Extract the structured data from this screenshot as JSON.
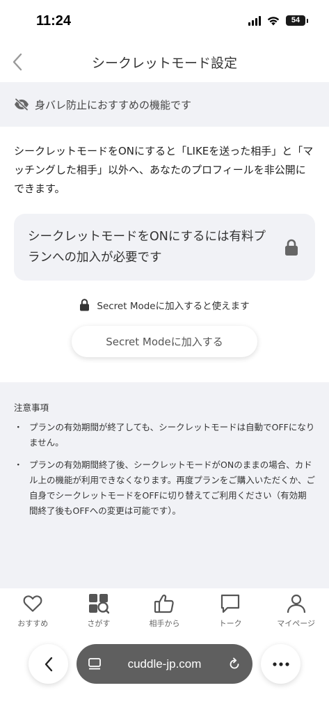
{
  "status_bar": {
    "time": "11:24",
    "battery": "54"
  },
  "header": {
    "title": "シークレットモード設定"
  },
  "feature_banner": {
    "text": "身バレ防止におすすめの機能です"
  },
  "description": "シークレットモードをONにすると「LIKEを送った相手」と「マッチングした相手」以外へ、あなたのプロフィールを非公開にできます。",
  "locked_card": {
    "text": "シークレットモードをONにするには有料プランへの加入が必要です"
  },
  "secret_note": "Secret Modeに加入すると使えます",
  "join_button": "Secret Modeに加入する",
  "notes": {
    "title": "注意事項",
    "items": [
      {
        "bullet": "・",
        "text": "プランの有効期間が終了しても、シークレットモードは自動でOFFになりません。"
      },
      {
        "bullet": "・",
        "text": "プランの有効期間終了後、シークレットモードがONのままの場合、カドル上の機能が利用できなくなります。再度プランをご購入いただくか、ご自身でシークレットモードをOFFに切り替えてご利用ください（有効期間終了後もOFFへの変更は可能です）。"
      }
    ]
  },
  "tabs": [
    {
      "label": "おすすめ",
      "icon": "heart-icon"
    },
    {
      "label": "さがす",
      "icon": "search-grid-icon"
    },
    {
      "label": "相手から",
      "icon": "thumbs-up-icon"
    },
    {
      "label": "トーク",
      "icon": "chat-bubble-icon"
    },
    {
      "label": "マイページ",
      "icon": "person-icon"
    }
  ],
  "browser": {
    "url": "cuddle-jp.com"
  }
}
